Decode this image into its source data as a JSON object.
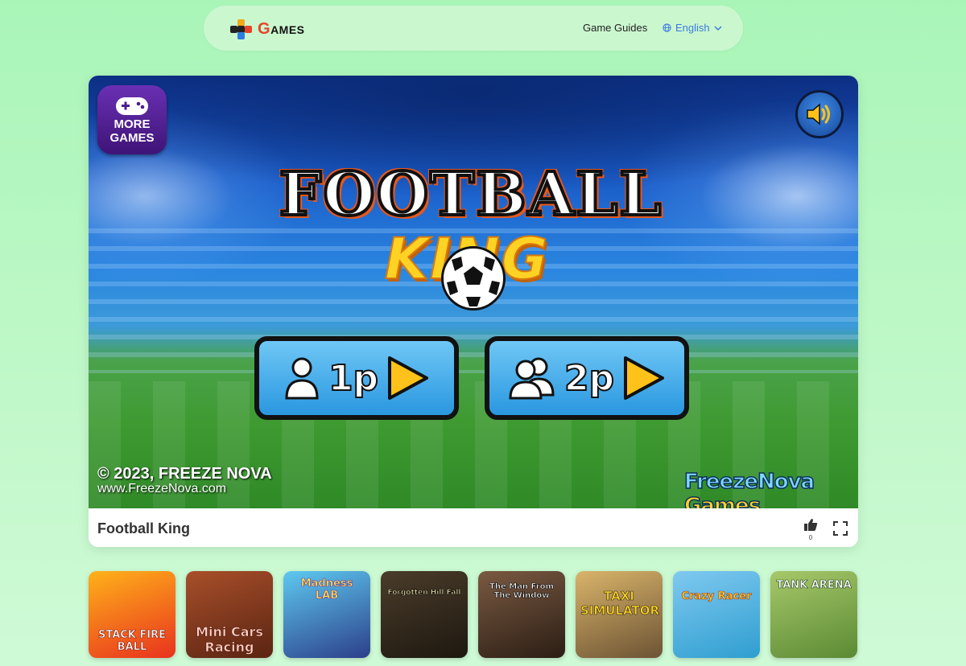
{
  "nav": {
    "logo_text_g": "G",
    "logo_text_rest": "AMES",
    "game_guides": "Game Guides",
    "language": "English"
  },
  "game": {
    "more_games_line1": "MORE",
    "more_games_line2": "GAMES",
    "title_line1": "FOOTBALL",
    "title_line2": "KING",
    "btn_1p": "1p",
    "btn_2p": "2p",
    "copyright": "© 2023, FREEZE NOVA",
    "website": "www.FreezeNova.com",
    "brand_part1": "FreezeNova",
    "brand_part2": "Games",
    "name": "Football King",
    "like_count": "0"
  },
  "thumbnails": [
    {
      "title": "STACK FIRE BALL",
      "colors": [
        "#ffb21a",
        "#e8321e"
      ]
    },
    {
      "title": "Mini Cars Racing",
      "colors": [
        "#a84f2a",
        "#5a2412"
      ]
    },
    {
      "title": "Madness LAB",
      "colors": [
        "#5ec9f0",
        "#2c3f8a"
      ]
    },
    {
      "title": "Forgotten Hill Fall",
      "colors": [
        "#4a3c2a",
        "#1e1810"
      ]
    },
    {
      "title": "The Man From The Window",
      "colors": [
        "#7a5a42",
        "#2b1d14"
      ]
    },
    {
      "title": "TAXI SIMULATOR",
      "colors": [
        "#d9b46a",
        "#6c5334"
      ]
    },
    {
      "title": "Crazy Racer",
      "colors": [
        "#7fc9f0",
        "#2f9ed0"
      ]
    },
    {
      "title": "TANK ARENA",
      "colors": [
        "#a7c86a",
        "#5b8a34"
      ]
    }
  ]
}
